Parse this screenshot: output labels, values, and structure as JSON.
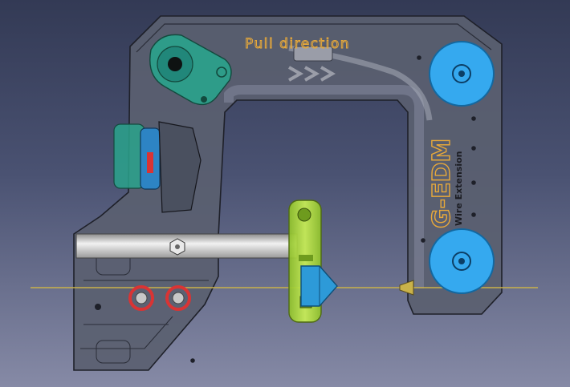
{
  "viewport": {
    "background_top": "#333a55",
    "background_bottom": "#868aa6"
  },
  "model": {
    "label_pull": "Pull direction",
    "label_brand": "G-EDM",
    "label_sub": "Wire Extension"
  },
  "colors": {
    "frame": "#5a5f70",
    "frame_edge": "#1e2029",
    "pulley_blue": "#35a9ef",
    "tension_arm": "#2aa38c",
    "tensioner_blue": "#2d84c4",
    "clamp_green": "#b4df35",
    "wire_nut": "#2d9ad8",
    "screw_red": "#d93434",
    "axis_line": "#c9b24a",
    "label_orange": "#e8a93a",
    "rod": "#d9d9d9"
  }
}
